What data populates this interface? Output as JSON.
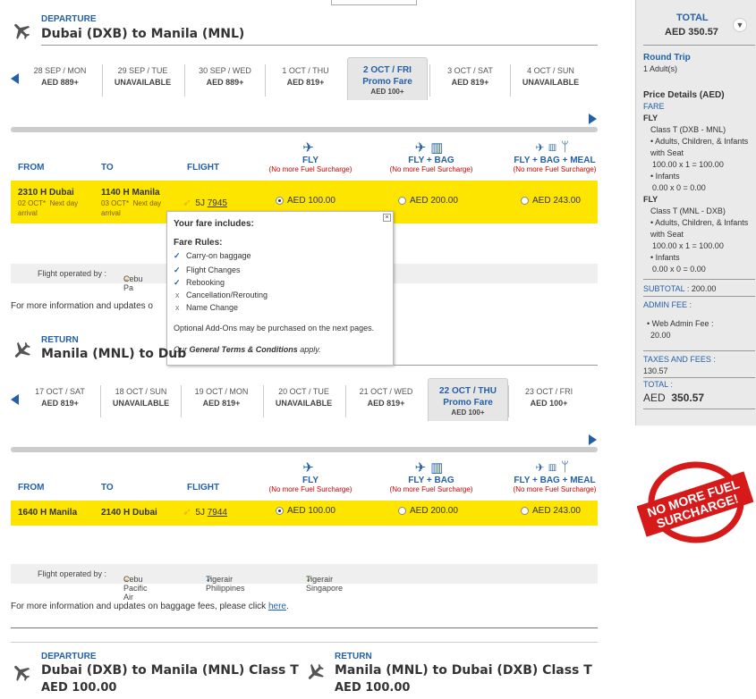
{
  "departure": {
    "label": "DEPARTURE",
    "route": "Dubai (DXB) to Manila (MNL)",
    "dates": [
      {
        "date": "28 SEP / MON",
        "price": "AED 889+"
      },
      {
        "date": "29 SEP / TUE",
        "price": "UNAVAILABLE"
      },
      {
        "date": "30 SEP / WED",
        "price": "AED 889+"
      },
      {
        "date": "1 OCT / THU",
        "price": "AED 819+"
      },
      {
        "date": "2 OCT / FRI",
        "promo": "Promo Fare",
        "price": "AED 100+",
        "selected": true
      },
      {
        "date": "3 OCT / SAT",
        "price": "AED 819+"
      },
      {
        "date": "4 OCT / SUN",
        "price": "UNAVAILABLE"
      }
    ],
    "flight": {
      "dep_time": "2310 H",
      "dep_city": "Dubai",
      "dep_note": "02 OCT*",
      "dep_note2": "Next day",
      "dep_note3": "arrival",
      "arr_time": "1140 H",
      "arr_city": "Manila",
      "arr_note": "03 OCT*",
      "arr_note2": "Next day",
      "arr_note3": "arrival",
      "carrier": "5J",
      "number": "7945",
      "fly": "AED 100.00",
      "fly_bag": "AED 200.00",
      "fly_bag_meal": "AED 243.00"
    },
    "operated_by": "Flight operated by :",
    "operator": "Cebu Pa"
  },
  "columns": {
    "from": "FROM",
    "to": "TO",
    "flight": "FLIGHT"
  },
  "fares": {
    "fly": "FLY",
    "fly_bag": "FLY + BAG",
    "fly_bag_meal": "FLY + BAG + MEAL",
    "note": "(No more Fuel Surcharge)"
  },
  "popup": {
    "heading": "Your fare includes:",
    "rules_heading": "Fare Rules:",
    "items": [
      {
        "text": "Carry-on baggage",
        "ok": true
      },
      {
        "text": "Flight Changes",
        "ok": true
      },
      {
        "text": "Rebooking",
        "ok": true
      },
      {
        "text": "Cancellation/Rerouting",
        "ok": false
      },
      {
        "text": "Name Change",
        "ok": false
      }
    ],
    "optional": "Optional Add-Ons may be purchased on the next pages.",
    "terms_pre": "Our",
    "terms_link": "General Terms & Conditions",
    "terms_post": "apply."
  },
  "more_info_short": "For more information and updates o",
  "more_info": "For more information and updates on baggage fees, please click",
  "more_info_link": "here",
  "return": {
    "label": "RETURN",
    "route_short": "Manila (MNL) to Dub",
    "route": "Manila (MNL) to Dubai (DXB)",
    "dates": [
      {
        "date": "17 OCT / SAT",
        "price": "AED 819+"
      },
      {
        "date": "18 OCT / SUN",
        "price": "UNAVAILABLE"
      },
      {
        "date": "19 OCT / MON",
        "price": "AED 819+"
      },
      {
        "date": "20 OCT / TUE",
        "price": "UNAVAILABLE"
      },
      {
        "date": "21 OCT / WED",
        "price": "AED 819+"
      },
      {
        "date": "22 OCT / THU",
        "promo": "Promo Fare",
        "price": "AED 100+",
        "selected": true
      },
      {
        "date": "23 OCT / FRI",
        "price": "AED 100+"
      }
    ],
    "flight": {
      "dep_time": "1640 H",
      "dep_city": "Manila",
      "arr_time": "2140 H",
      "arr_city": "Dubai",
      "carrier": "5J",
      "number": "7944",
      "fly": "AED 100.00",
      "fly_bag": "AED 200.00",
      "fly_bag_meal": "AED 243.00"
    },
    "operated_by": "Flight operated by :",
    "operators": [
      "Cebu Pacific Air",
      "Tigerair Philippines",
      "Tigerair Singapore"
    ]
  },
  "summary": {
    "dep_label": "DEPARTURE",
    "dep_route": "Dubai (DXB) to Manila (MNL) Class T",
    "dep_price": "AED 100.00",
    "ret_label": "RETURN",
    "ret_route": "Manila (MNL) to Dubai (DXB) Class T",
    "ret_price": "AED 100.00"
  },
  "sidebar": {
    "total_label": "TOTAL",
    "total_value": "AED 350.57",
    "trip_type": "Round Trip",
    "pax": "1 Adult(s)",
    "price_details": "Price Details (AED)",
    "fare_label": "FARE",
    "fly1": "FLY",
    "class1": "Class T (DXB - MNL)",
    "adults1": "• Adults, Children, & Infants",
    "seat1": "with Seat",
    "calc1": "100.00 x 1 = 100.00",
    "inf1": "• Infants",
    "infcalc1": "0.00 x 0 = 0.00",
    "fly2": "FLY",
    "class2": "Class T (MNL - DXB)",
    "adults2": "• Adults, Children, & Infants",
    "seat2": "with Seat",
    "calc2": "100.00 x 1 = 100.00",
    "inf2": "• Infants",
    "infcalc2": "0.00 x 0 = 0.00",
    "subtotal_label": "SUBTOTAL :",
    "subtotal_value": "200.00",
    "admin_label": "ADMIN FEE :",
    "admin_item": "• Web Admin Fee :",
    "admin_value": "20.00",
    "taxes_label": "TAXES AND FEES :",
    "taxes_value": "130.57",
    "grand_label": "TOTAL :",
    "grand_cur": "AED",
    "grand_value": "350.57"
  },
  "stamp": {
    "line1": "NO MORE FUEL",
    "line2": "SURCHARGE!"
  }
}
